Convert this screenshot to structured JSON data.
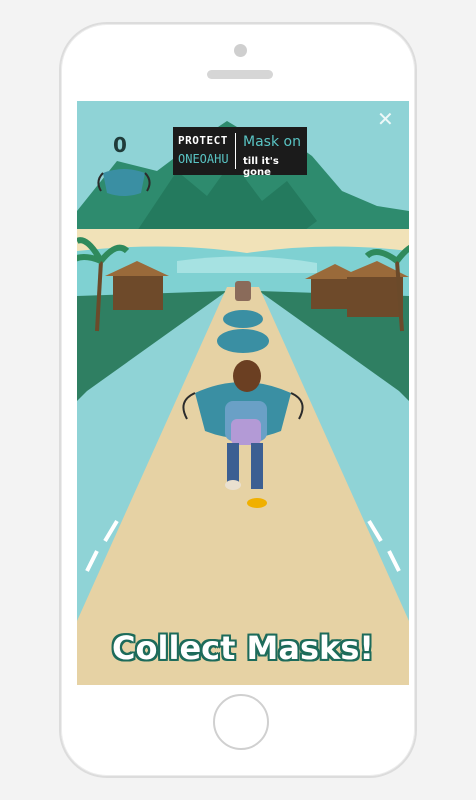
{
  "game": {
    "score": "0",
    "close_glyph": "✕",
    "banner": {
      "line1": "PROTECT",
      "line2": "ONEOAHU",
      "tagline1": "Mask on",
      "tagline2": "till it's gone"
    },
    "caption": "Collect Masks!",
    "score_icon": "face-mask-icon"
  },
  "colors": {
    "sky": "#8fd3d6",
    "mountain": "#2e8b6e",
    "road": "#e6d2a4",
    "ocean": "#7fd1d2",
    "caption_outline": "#1d6b5a",
    "mask": "#3a8fa3"
  }
}
